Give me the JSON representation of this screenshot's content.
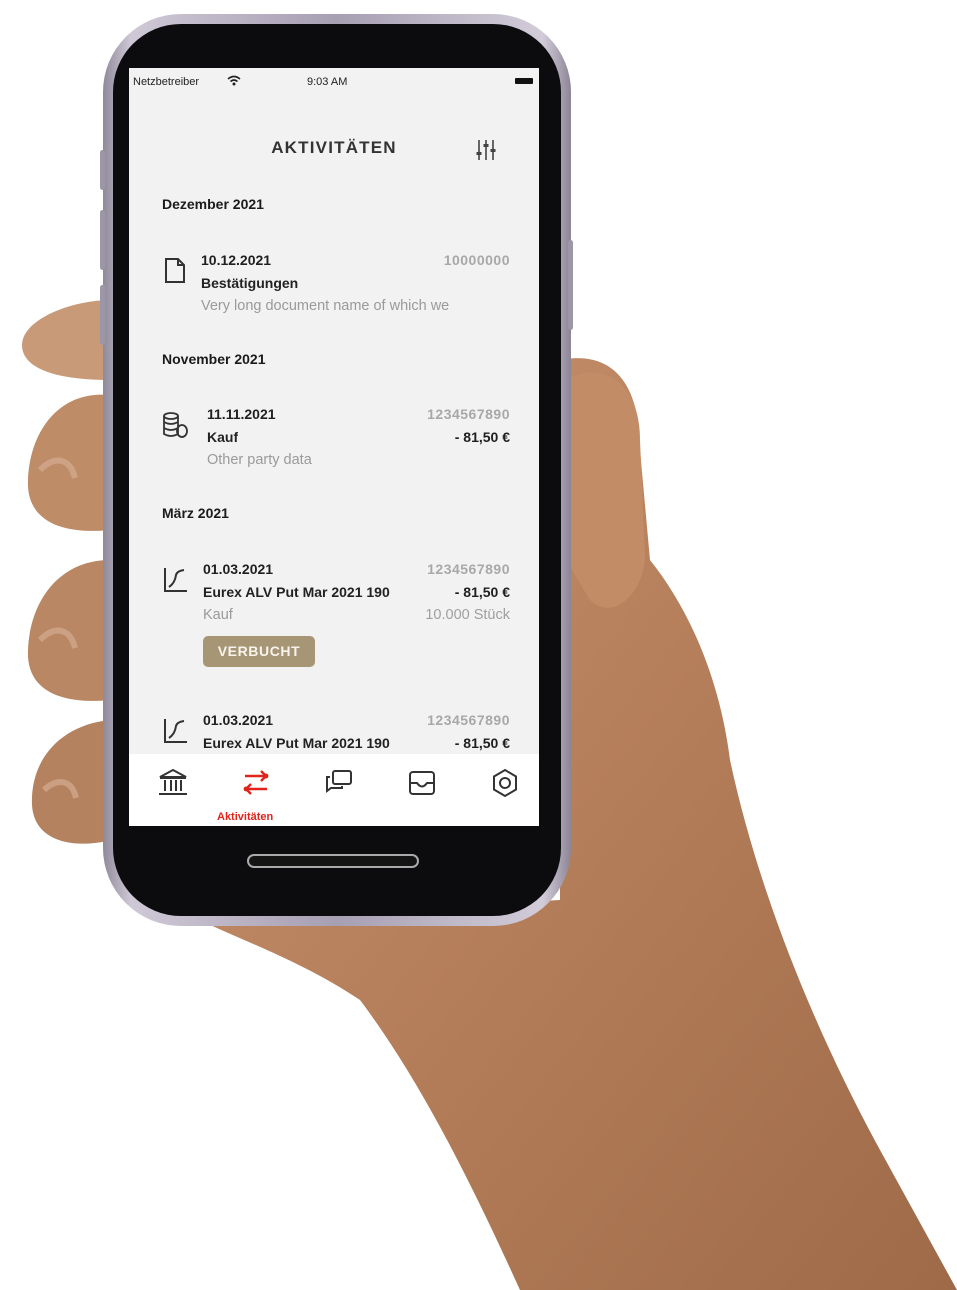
{
  "status_bar": {
    "carrier": "Netzbetreiber",
    "time": "9:03 AM"
  },
  "header": {
    "title": "AKTIVITÄTEN",
    "filter_icon": "filter-sliders-icon"
  },
  "months": [
    "Dezember 2021",
    "November 2021",
    "März 2021"
  ],
  "activities": [
    {
      "icon": "document-icon",
      "date": "10.12.2021",
      "ref": "10000000",
      "name": "Bestätigungen",
      "sub": "Very long document name of which we"
    },
    {
      "icon": "coins-icon",
      "date": "11.11.2021",
      "ref": "1234567890",
      "name": "Kauf",
      "amount": "- 81,50 €",
      "sub": "Other party data"
    },
    {
      "icon": "chart-icon",
      "date": "01.03.2021",
      "ref": "1234567890",
      "name": "Eurex ALV Put Mar 2021 190",
      "amount": "- 81,50 €",
      "sub": "Kauf",
      "qty": "10.000 Stück",
      "badge": "VERBUCHT"
    },
    {
      "icon": "chart-icon",
      "date": "01.03.2021",
      "ref": "1234567890",
      "name": "Eurex ALV Put Mar 2021 190",
      "amount": "- 81,50 €"
    }
  ],
  "tabbar": {
    "items": [
      "bank-icon",
      "transfer-icon",
      "chat-icon",
      "inbox-icon",
      "settings-icon"
    ],
    "active_label": "Aktivitäten",
    "active_color": "#e2231a"
  },
  "colors": {
    "badge": "#a79676",
    "screen_bg": "#f2f2f2"
  }
}
